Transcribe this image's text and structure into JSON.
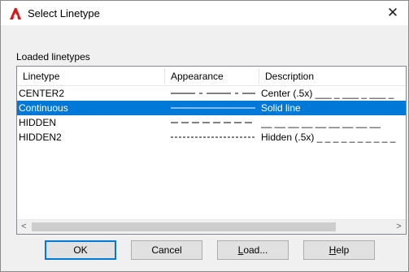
{
  "window": {
    "title": "Select Linetype",
    "app_icon": "autocad-a-icon",
    "close_glyph": "✕"
  },
  "group": {
    "label": "Loaded linetypes"
  },
  "columns": [
    "Linetype",
    "Appearance",
    "Description"
  ],
  "rows": [
    {
      "name": "CENTER2",
      "appearance": "center",
      "description": "Center (.5x) ___ _ ___ _ ___ _",
      "selected": false
    },
    {
      "name": "Continuous",
      "appearance": "solid",
      "description": "Solid line",
      "selected": true
    },
    {
      "name": "HIDDEN",
      "appearance": "hidden",
      "description": "__ __ __ __ __ __ __ __ __",
      "selected": false
    },
    {
      "name": "HIDDEN2",
      "appearance": "hidden2",
      "description": "Hidden (.5x) _ _ _ _ _ _ _ _ _ _",
      "selected": false
    }
  ],
  "scrollbar": {
    "left_glyph": "<",
    "right_glyph": ">"
  },
  "buttons": {
    "ok": "OK",
    "cancel": "Cancel",
    "load_prefix": "",
    "load_underline": "L",
    "load_rest": "oad...",
    "help_prefix": "",
    "help_underline": "H",
    "help_rest": "elp"
  },
  "colors": {
    "selection": "#0078d7",
    "app_icon_red": "#d11a1a"
  }
}
